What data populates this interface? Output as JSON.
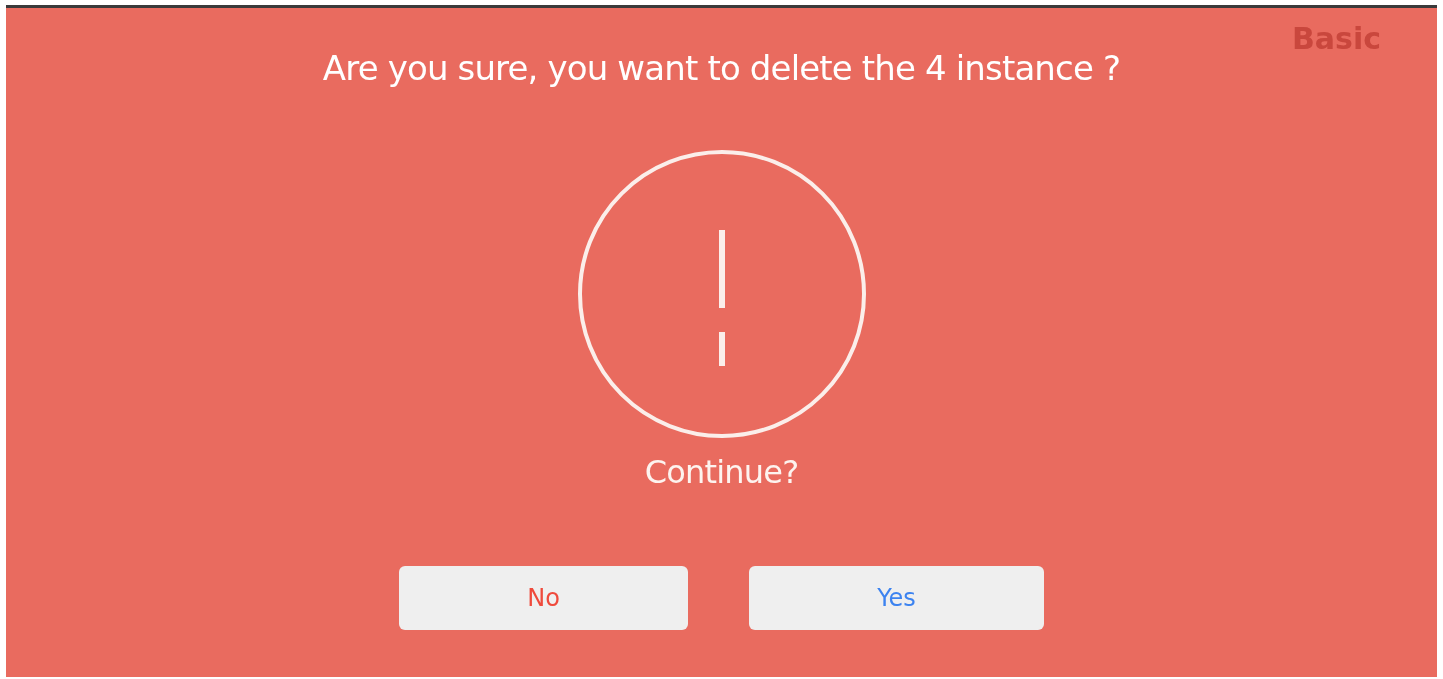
{
  "background_label": "Basic",
  "dialog": {
    "title": "Are you sure, you want to delete the 4 instance ?",
    "prompt": "Continue?",
    "buttons": [
      {
        "label": "No",
        "kind": "cancel"
      },
      {
        "label": "Yes",
        "kind": "confirm"
      }
    ]
  }
}
